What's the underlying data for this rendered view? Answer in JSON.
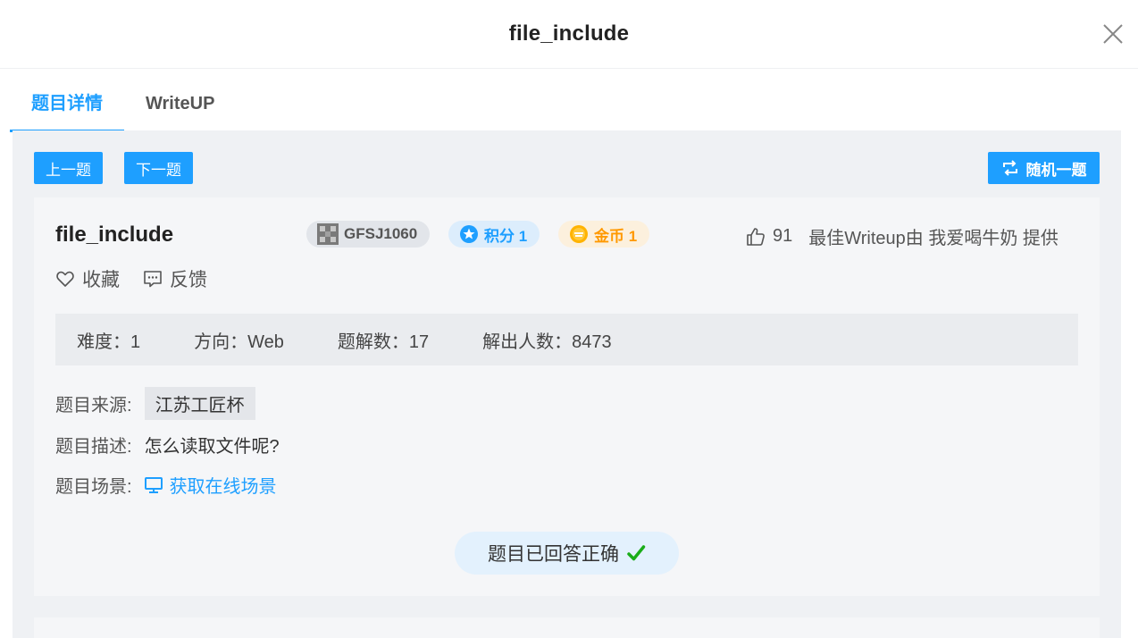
{
  "modal": {
    "title": "file_include"
  },
  "tabs": [
    {
      "label": "题目详情",
      "active": true
    },
    {
      "label": "WriteUP",
      "active": false
    }
  ],
  "nav": {
    "prev_label": "上一题",
    "next_label": "下一题",
    "random_label": "随机一题"
  },
  "challenge": {
    "title": "file_include",
    "id": "GFSJ1060",
    "score_label": "积分 1",
    "coin_label": "金币 1",
    "likes": "91",
    "best_writeup": "最佳Writeup由 我爱喝牛奶 提供",
    "favorite_label": "收藏",
    "feedback_label": "反馈"
  },
  "stats": {
    "difficulty": "难度：1",
    "direction": "方向：Web",
    "writeups": "题解数：17",
    "solvers": "解出人数：8473"
  },
  "info": {
    "source_label": "题目来源:",
    "source_value": "江苏工匠杯",
    "desc_label": "题目描述:",
    "desc_value": "怎么读取文件呢?",
    "scene_label": "题目场景:",
    "scene_link": "获取在线场景"
  },
  "status": {
    "answered": "题目已回答正确"
  },
  "colors": {
    "accent": "#1e9fff",
    "coin": "#ff9900",
    "success": "#1aad19"
  }
}
